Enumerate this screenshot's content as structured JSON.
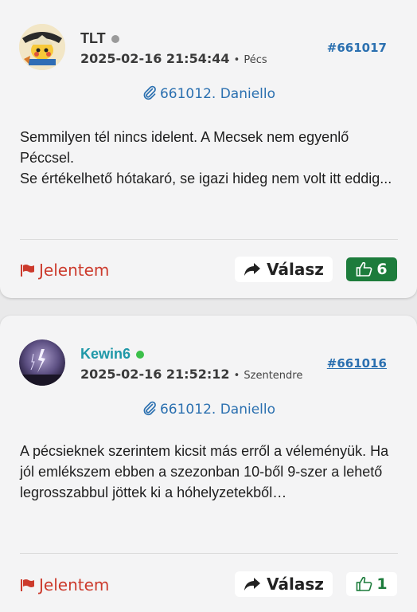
{
  "posts": [
    {
      "author": "TLT",
      "status_color": "#9a9a9a",
      "author_color": "#333333",
      "date": "2025-02-16 21:54:44",
      "separator": "•",
      "location": "Pécs",
      "post_id": "#661017",
      "reply_to": "661012. Daniello",
      "body": [
        "Semmilyen tél nincs idelent. A Mecsek nem egyenlő Péccsel.",
        "Se értékelhető hótakaró, se igazi hideg nem volt itt eddig..."
      ],
      "report_label": "Jelentem",
      "reply_label": "Válasz",
      "likes": "6"
    },
    {
      "author": "Kewin6",
      "status_color": "#3cc04a",
      "author_color": "#1f98a8",
      "date": "2025-02-16 21:52:12",
      "separator": "•",
      "location": "Szentendre",
      "post_id": "#661016",
      "reply_to": "661012. Daniello",
      "body": [
        "A pécsieknek szerintem kicsit más erről a véleményük. Ha jól emlékszem ebben a szezonban 10-ből 9-szer a lehető legrosszabbul jöttek ki a hóhelyzetekből…"
      ],
      "report_label": "Jelentem",
      "reply_label": "Válasz",
      "likes": "1"
    }
  ],
  "colors": {
    "link": "#2b70b0",
    "report": "#cc3a2c",
    "like_green": "#1d7c3c"
  },
  "icons": {
    "attachment": "paperclip-icon",
    "report": "flag-icon",
    "reply": "share-arrow-icon",
    "like": "thumbs-up-icon"
  }
}
